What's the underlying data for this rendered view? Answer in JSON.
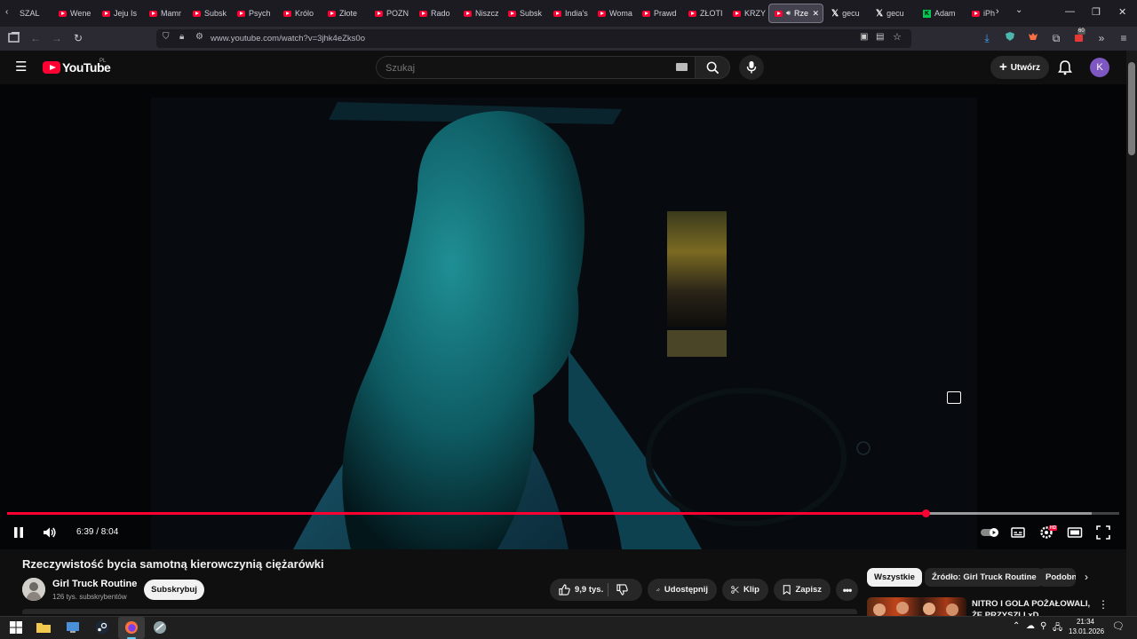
{
  "browser": {
    "tabs": [
      {
        "label": "SZAL",
        "icon": "none"
      },
      {
        "label": "Wene",
        "icon": "youtube-icon"
      },
      {
        "label": "Jeju Is",
        "icon": "youtube-icon"
      },
      {
        "label": "Mamr",
        "icon": "youtube-icon"
      },
      {
        "label": "Subsk",
        "icon": "youtube-icon"
      },
      {
        "label": "Psych",
        "icon": "youtube-icon"
      },
      {
        "label": "Królo",
        "icon": "youtube-icon"
      },
      {
        "label": "Złote",
        "icon": "youtube-icon"
      },
      {
        "label": "POZN",
        "icon": "youtube-icon"
      },
      {
        "label": "Rado",
        "icon": "youtube-icon"
      },
      {
        "label": "Niszcz",
        "icon": "youtube-icon"
      },
      {
        "label": "Subsk",
        "icon": "youtube-icon"
      },
      {
        "label": "India's",
        "icon": "youtube-icon"
      },
      {
        "label": "Woma",
        "icon": "youtube-icon"
      },
      {
        "label": "Prawd",
        "icon": "youtube-icon"
      },
      {
        "label": "ZŁOTI",
        "icon": "youtube-icon"
      },
      {
        "label": "KRZY",
        "icon": "youtube-icon"
      },
      {
        "label": "Rze",
        "icon": "youtube-icon",
        "active": true,
        "close": "✕"
      },
      {
        "label": "gecu",
        "icon": "x-icon"
      },
      {
        "label": "gecu",
        "icon": "x-icon"
      },
      {
        "label": "Adam",
        "icon": "k-icon"
      },
      {
        "label": "iPho",
        "icon": "youtube-icon"
      }
    ],
    "url": "www.youtube.com/watch?v=3jhk4eZks0o",
    "extension_badge": "60"
  },
  "youtube": {
    "logo_text": "YouTube",
    "country_code": "PL",
    "search_placeholder": "Szukaj",
    "create_label": "Utwórz",
    "avatar_letter": "K",
    "accent": "#ff0033"
  },
  "player": {
    "current_time": "6:39",
    "duration": "8:04",
    "time_display": "6:39 / 8:04",
    "played_fraction": 0.826,
    "buffered_fraction": 0.975,
    "state": "playing",
    "quality_badge": "HD"
  },
  "video": {
    "title": "Rzeczywistość bycia samotną kierowczynią ciężarówki",
    "channel": "Girl Truck Routine",
    "subscribers": "126 tys. subskrybentów",
    "subscribe_label": "Subskrybuj",
    "likes": "9,9 tys.",
    "share_label": "Udostępnij",
    "clip_label": "Klip",
    "save_label": "Zapisz"
  },
  "sidebar": {
    "chips": [
      "Wszystkie",
      "Źródło: Girl Truck Routine",
      "Podobne"
    ],
    "recommendation_title": "NITRO I GOLA POŻAŁOWALI, ŻE PRZYSZLI xD"
  },
  "taskbar": {
    "time": "21:34",
    "date": "13.01.2026"
  }
}
